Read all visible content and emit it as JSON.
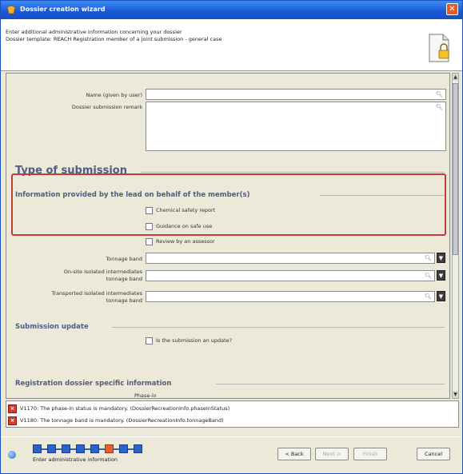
{
  "window": {
    "title": "Dossier creation wizard"
  },
  "header": {
    "line1": "Enter additional administrative information concerning your dossier",
    "line2": "Dossier template: REACH Registration member of a joint submission - general case"
  },
  "form": {
    "name_label": "Name (given by user)",
    "name_value": "",
    "remark_label": "Dossier submission remark",
    "remark_value": "",
    "type_heading": "Type of submission",
    "lead_heading": "Information provided by the lead on behalf of the member(s)",
    "checks": [
      {
        "label": "Chemical safety report",
        "checked": false
      },
      {
        "label": "Guidance on safe use",
        "checked": false
      },
      {
        "label": "Review by an assessor",
        "checked": false
      }
    ],
    "tonnage_label": "Tonnage band",
    "tonnage_value": "",
    "onsite_label_1": "On-site isolated intermediates",
    "onsite_label_2": "tonnage band",
    "onsite_value": "",
    "transported_label_1": "Transported isolated intermediates",
    "transported_label_2": "tonnage band",
    "transported_value": "",
    "update_heading": "Submission update",
    "update_check": {
      "label": "Is the submission an update?",
      "checked": false
    },
    "registration_heading": "Registration dossier specific information",
    "phase_label": "Phase-in"
  },
  "messages": [
    {
      "text": "V1170: The phase-in status is mandatory. (DossierRecreationInfo.phaseInStatus)"
    },
    {
      "text": "V1180: The tonnage band is mandatory. (DossierRecreationInfo.tonnageBand)"
    }
  ],
  "footer": {
    "step_label": "Enter administrative information",
    "total_steps": 8,
    "current_step": 6,
    "buttons": {
      "back": "< Back",
      "next": "Next >",
      "finish": "Finish",
      "cancel": "Cancel"
    }
  },
  "colors": {
    "titlebar": "#1a5ad6",
    "section_heading": "#4c5e86",
    "highlight": "#c33a3a",
    "error": "#d23b2e",
    "current_step": "#e0612b"
  }
}
